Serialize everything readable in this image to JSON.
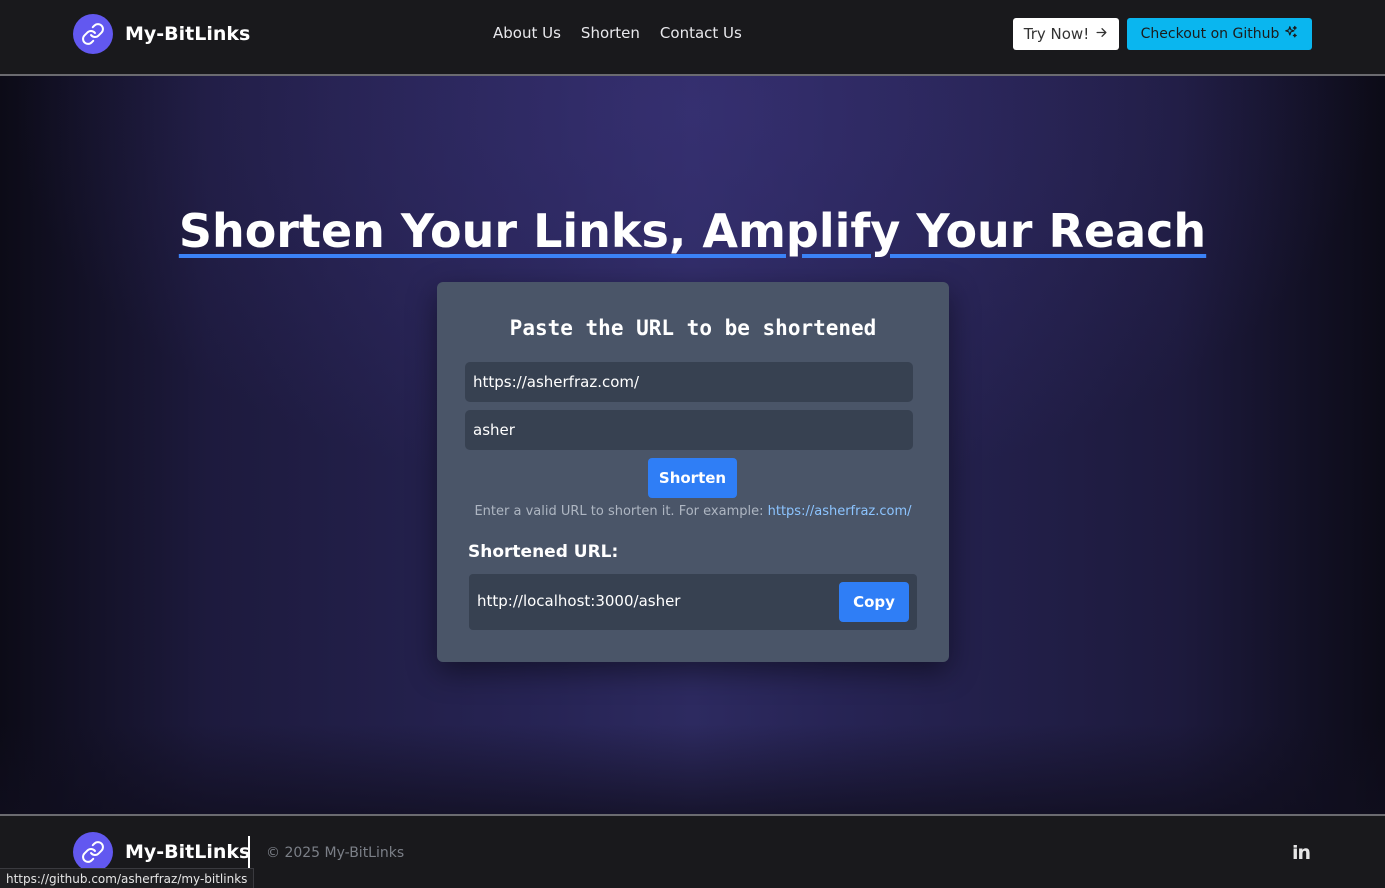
{
  "header": {
    "brand_name": "My-BitLinks",
    "logo_icon": "link-icon",
    "nav": [
      {
        "label": "About Us"
      },
      {
        "label": "Shorten"
      },
      {
        "label": "Contact Us"
      }
    ],
    "try_now_label": "Try Now!",
    "github_label": "Checkout on Github"
  },
  "hero": {
    "title": "Shorten Your Links, Amplify Your Reach"
  },
  "form": {
    "title": "Paste the URL to be shortened",
    "url_value": "https://asherfraz.com/",
    "alias_value": "asher",
    "shorten_label": "Shorten",
    "hint_text": "Enter a valid URL to shorten it. For example:",
    "hint_link": "https://asherfraz.com/",
    "shortened_label": "Shortened URL:",
    "shortened_value": "http://localhost:3000/asher",
    "copy_label": "Copy"
  },
  "footer": {
    "brand_name": "My-BitLinks",
    "copyright": "© 2025 My-BitLinks",
    "social_icon": "linkedin-icon"
  },
  "status_bar": {
    "url": "https://github.com/asherfraz/my-bitlinks"
  },
  "colors": {
    "accent": "#3b82f6",
    "logo": "#6258f0",
    "github_button": "#0ab6ef",
    "card": "#4a5568",
    "input": "#374151"
  }
}
